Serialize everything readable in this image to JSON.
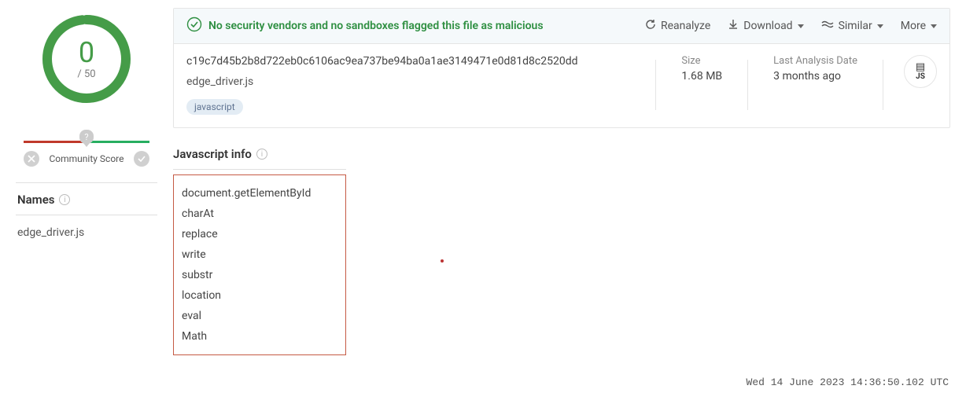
{
  "score": {
    "value": "0",
    "total": "/ 50"
  },
  "community": {
    "bubble": "?",
    "label": "Community Score"
  },
  "names": {
    "header": "Names",
    "items": [
      "edge_driver.js"
    ]
  },
  "banner": {
    "text": "No security vendors and no sandboxes flagged this file as malicious",
    "actions": {
      "reanalyze": "Reanalyze",
      "download": "Download",
      "similar": "Similar",
      "more": "More"
    }
  },
  "file": {
    "hash": "c19c7d45b2b8d722eb0c6106ac9ea737be94ba0a1ae3149471e0d81d8c2520dd",
    "name": "edge_driver.js",
    "tags": [
      "javascript"
    ],
    "type_ext": "JS"
  },
  "meta": {
    "size_label": "Size",
    "size_value": "1.68 MB",
    "date_label": "Last Analysis Date",
    "date_value": "3 months ago"
  },
  "jsinfo": {
    "header": "Javascript info",
    "items": [
      "document.getElementById",
      "charAt",
      "replace",
      "write",
      "substr",
      "location",
      "eval",
      "Math"
    ]
  },
  "footer": {
    "timestamp": "Wed 14 June 2023 14:36:50.102 UTC"
  }
}
